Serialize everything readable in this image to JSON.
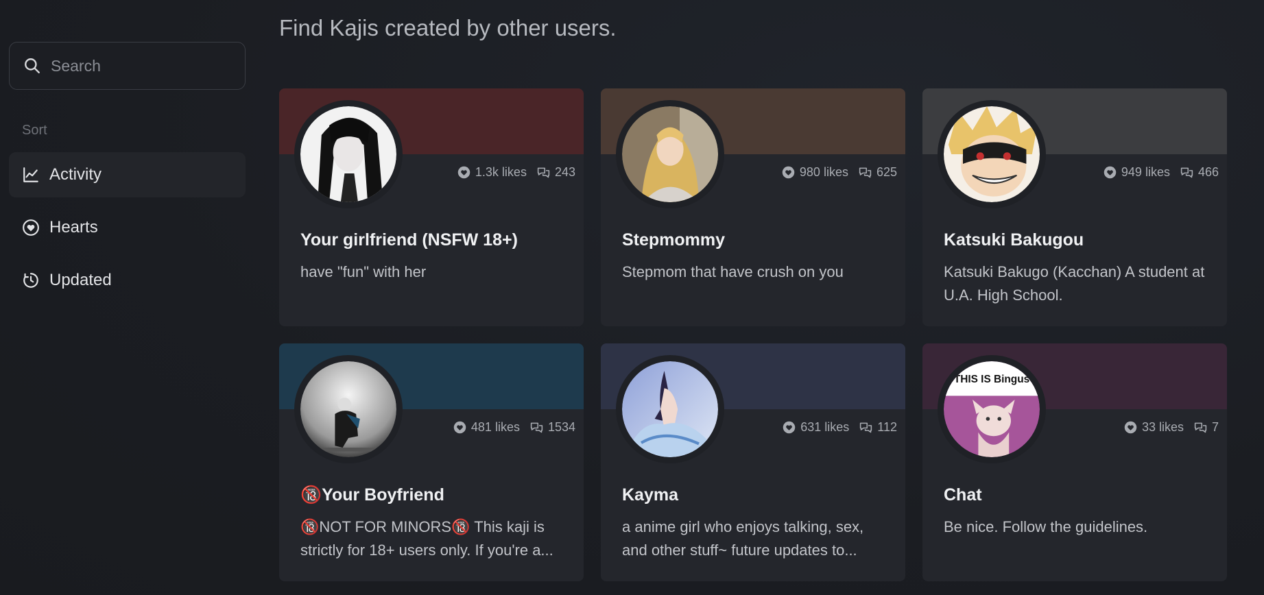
{
  "heading": "Find Kajis created by other users.",
  "search": {
    "placeholder": "Search",
    "icon": "search-icon"
  },
  "sort": {
    "label": "Sort",
    "items": [
      {
        "label": "Activity",
        "icon": "chart-line-icon",
        "active": true
      },
      {
        "label": "Hearts",
        "icon": "heart-circle-icon",
        "active": false
      },
      {
        "label": "Updated",
        "icon": "clock-refresh-icon",
        "active": false
      }
    ]
  },
  "cards": [
    {
      "title": "Your girlfriend (NSFW 18+)",
      "description": "have \"fun\" with her",
      "likes": "1.3k likes",
      "comments": "243",
      "banner": "#4a2528"
    },
    {
      "title": "Stepmommy",
      "description": "Stepmom that have crush on you",
      "likes": "980 likes",
      "comments": "625",
      "banner": "#4a3a33"
    },
    {
      "title": "Katsuki Bakugou",
      "description": "Katsuki Bakugo (Kacchan) A student at U.A. High School.",
      "likes": "949 likes",
      "comments": "466",
      "banner": "#3c3d40"
    },
    {
      "title": "🔞Your Boyfriend",
      "description": "🔞NOT FOR MINORS🔞 This kaji is strictly for 18+ users only. If you're a...",
      "likes": "481 likes",
      "comments": "1534",
      "banner": "#1e3a4d"
    },
    {
      "title": "Kayma",
      "description": "a anime girl who enjoys talking, sex, and other stuff~ future updates to...",
      "likes": "631 likes",
      "comments": "112",
      "banner": "#2e3346"
    },
    {
      "title": "Chat",
      "description": "Be nice. Follow the guidelines.",
      "likes": "33 likes",
      "comments": "7",
      "banner": "#392637",
      "avatar_caption": "THIS IS Bingus"
    }
  ],
  "colors": {
    "background": "#1b1d22",
    "card": "#24262c",
    "text_muted": "#a9acb2"
  }
}
